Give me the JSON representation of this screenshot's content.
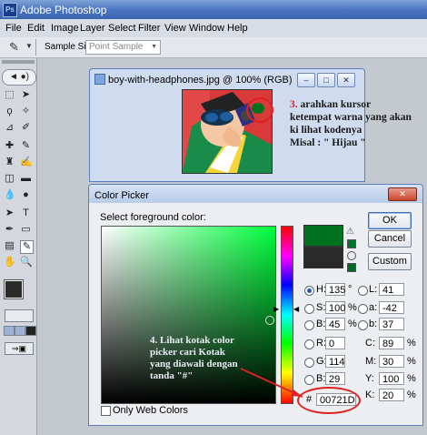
{
  "app": {
    "title": "Adobe Photoshop",
    "logo": "Ps"
  },
  "menu": [
    "File",
    "Edit",
    "Image",
    "Layer",
    "Select",
    "Filter",
    "View",
    "Window",
    "Help"
  ],
  "options_bar": {
    "sample_size_label": "Sample Size:",
    "sample_size_value": "Point Sample"
  },
  "document": {
    "title": "boy-with-headphones.jpg @ 100% (RGB)"
  },
  "annotation_top": {
    "number": "3.",
    "lines": [
      "arahkan kursor",
      "ketempat warna yang akan",
      "ki lihat kodenya",
      "Misal : \" Hijau \""
    ]
  },
  "annotation_bottom": {
    "lines": [
      "4. Lihat kotak color",
      "picker cari Kotak",
      "yang diawali dengan",
      "tanda \"#\""
    ]
  },
  "color_picker": {
    "title": "Color Picker",
    "subtitle": "Select foreground color:",
    "ok_label": "OK",
    "cancel_label": "Cancel",
    "custom_label": "Custom",
    "only_web_colors": "Only Web Colors",
    "fields": {
      "H": {
        "label": "H:",
        "value": "135",
        "unit": "°"
      },
      "S": {
        "label": "S:",
        "value": "100",
        "unit": "%"
      },
      "B": {
        "label": "B:",
        "value": "45",
        "unit": "%"
      },
      "R": {
        "label": "R:",
        "value": "0"
      },
      "G": {
        "label": "G:",
        "value": "114"
      },
      "Bl": {
        "label": "B:",
        "value": "29"
      },
      "L": {
        "label": "L:",
        "value": "41"
      },
      "a": {
        "label": "a:",
        "value": "-42"
      },
      "b": {
        "label": "b:",
        "value": "37"
      },
      "C": {
        "label": "C:",
        "value": "89",
        "unit": "%"
      },
      "M": {
        "label": "M:",
        "value": "30",
        "unit": "%"
      },
      "Y": {
        "label": "Y:",
        "value": "100",
        "unit": "%"
      },
      "K": {
        "label": "K:",
        "value": "20",
        "unit": "%"
      }
    },
    "hex": {
      "label": "#",
      "value": "00721D"
    },
    "new_color": "#00721d",
    "current_color": "#2a2a2a"
  },
  "colors": {
    "title_bar": "#4a74c0",
    "highlight_circle": "#e02020",
    "annotation_text": "#e8ecf2"
  }
}
